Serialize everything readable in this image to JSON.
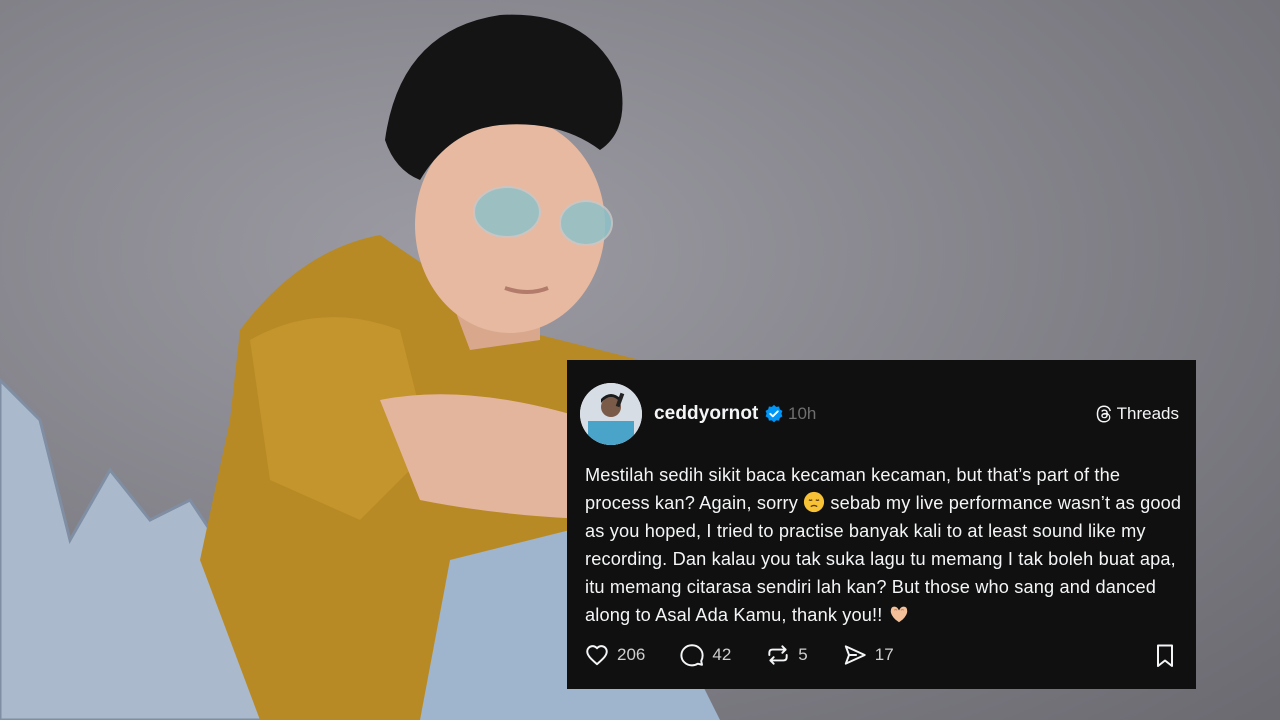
{
  "post": {
    "username": "ceddyornot",
    "time": "10h",
    "brand": "Threads",
    "text_1": "Mestilah sedih sikit baca kecaman kecaman, but that’s part of the process kan? Again, sorry ",
    "text_2": " sebab my live performance wasn’t as good as you hoped, I tried to practise banyak kali to at least sound like my recording. Dan kalau you tak suka lagu tu memang I tak boleh buat apa, itu memang citarasa sendiri lah kan? But those who sang and danced along to Asal Ada Kamu, thank you!! ",
    "emoji_1": "disappointed-face-emoji",
    "emoji_2": "heart-hands-emoji"
  },
  "actions": {
    "likes": "206",
    "replies": "42",
    "reposts": "5",
    "shares": "17"
  },
  "icons": [
    "verified-badge-icon",
    "threads-logo-icon",
    "heart-icon",
    "comment-icon",
    "repost-icon",
    "share-icon",
    "bookmark-icon"
  ],
  "colors": {
    "card_bg": "#101010",
    "text": "#f3f5f7",
    "muted": "#6f6f6f",
    "verified": "#0095f6",
    "background": "#8e8d95"
  }
}
